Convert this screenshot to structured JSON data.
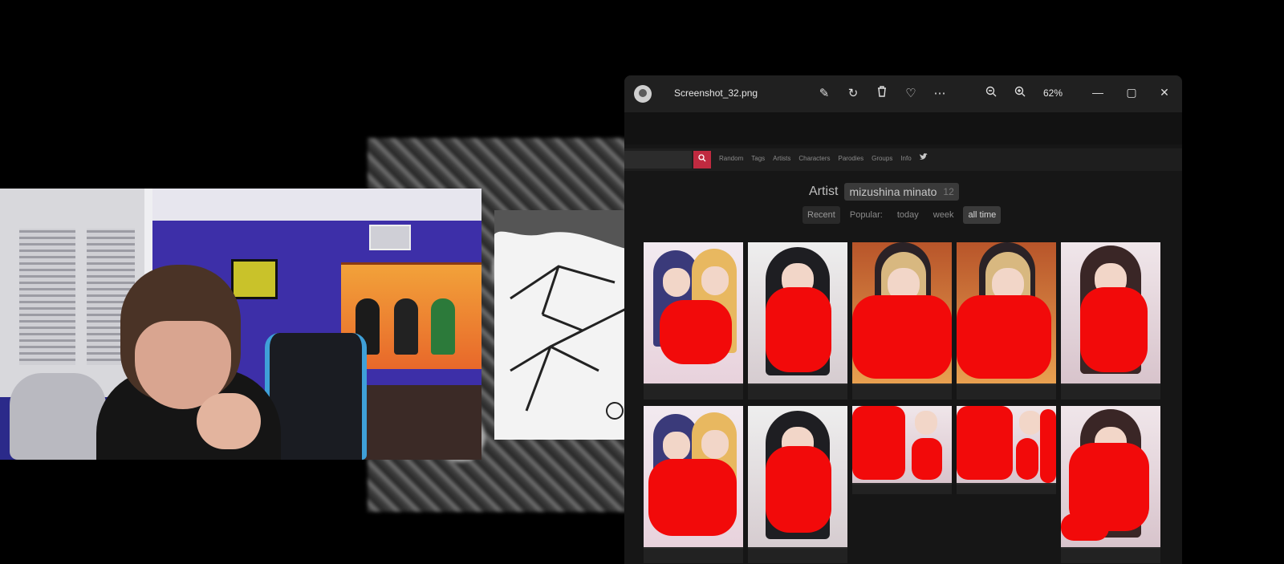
{
  "viewer": {
    "file_name": "Screenshot_32.png",
    "zoom": "62%",
    "toolbar": [
      {
        "name": "edit-image-icon",
        "glyph": "✎"
      },
      {
        "name": "rotate-icon",
        "glyph": "↻"
      },
      {
        "name": "delete-icon",
        "glyph": "🗑"
      },
      {
        "name": "favorite-icon",
        "glyph": "♡"
      },
      {
        "name": "more-icon",
        "glyph": "⋯"
      },
      {
        "name": "zoom-out-icon",
        "glyph": "−"
      },
      {
        "name": "zoom-in-icon",
        "glyph": "+"
      }
    ],
    "window_controls": {
      "minimize": "—",
      "maximize": "▢",
      "close": "✕"
    }
  },
  "site": {
    "nav": [
      "Random",
      "Tags",
      "Artists",
      "Characters",
      "Parodies",
      "Groups",
      "Info"
    ],
    "artist_label": "Artist",
    "artist_name": "mizushina minato",
    "artist_count": "12",
    "sort": {
      "recent": "Recent",
      "popular": "Popular:",
      "today": "today",
      "week": "week",
      "all_time": "all time"
    }
  },
  "colors": {
    "accent": "#c02a40",
    "redaction": "#f20a0a",
    "app_bg": "#191919"
  }
}
